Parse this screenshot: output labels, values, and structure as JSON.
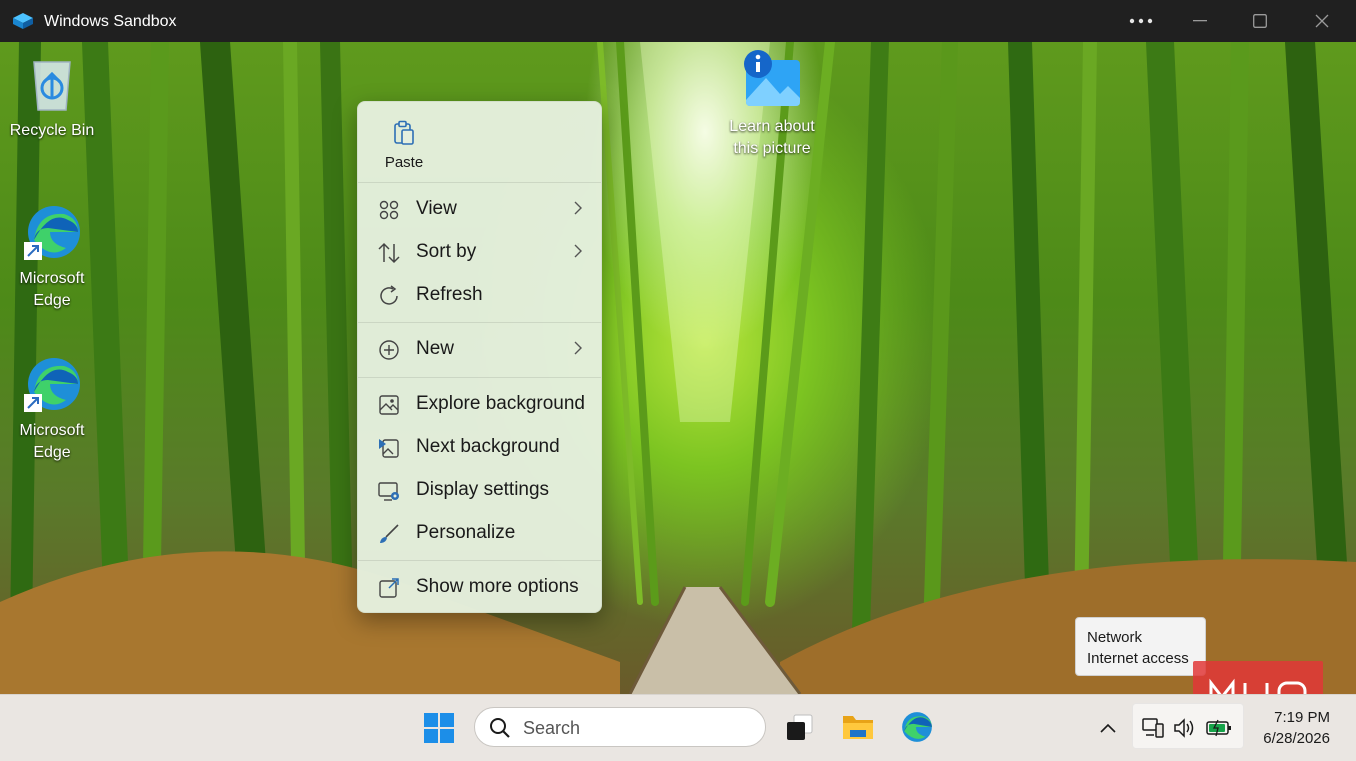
{
  "window": {
    "title": "Windows Sandbox",
    "controls": {
      "more": "more-icon",
      "minimize": "minimize-icon",
      "maximize": "maximize-icon",
      "close": "close-icon"
    }
  },
  "desktop": {
    "icons": [
      {
        "label": "Recycle Bin",
        "icon": "recycle-bin-icon"
      },
      {
        "label": "Microsoft Edge",
        "icon": "edge-shortcut-icon"
      },
      {
        "label": "Microsoft Edge",
        "icon": "edge-shortcut-icon"
      },
      {
        "label": "Learn about this picture",
        "icon": "learn-picture-icon"
      }
    ]
  },
  "context_menu": {
    "paste_label": "Paste",
    "items": [
      {
        "label": "View",
        "icon": "view-grid-icon",
        "submenu": true
      },
      {
        "label": "Sort by",
        "icon": "sort-icon",
        "submenu": true
      },
      {
        "label": "Refresh",
        "icon": "refresh-icon",
        "submenu": false
      },
      {
        "label": "New",
        "icon": "new-plus-icon",
        "submenu": true
      },
      {
        "label": "Explore background",
        "icon": "explore-background-icon",
        "submenu": false
      },
      {
        "label": "Next background",
        "icon": "next-background-icon",
        "submenu": false
      },
      {
        "label": "Display settings",
        "icon": "display-settings-icon",
        "submenu": false
      },
      {
        "label": "Personalize",
        "icon": "personalize-brush-icon",
        "submenu": false
      },
      {
        "label": "Show more options",
        "icon": "show-more-options-icon",
        "submenu": false
      }
    ]
  },
  "tooltip": {
    "line1": "Network",
    "line2": "Internet access"
  },
  "watermark": {
    "text": "MUO"
  },
  "taskbar": {
    "search_placeholder": "Search",
    "pinned": [
      "start-icon",
      "task-view-icon",
      "file-explorer-icon",
      "edge-icon"
    ],
    "tray": [
      "network-icon",
      "volume-icon",
      "battery-icon"
    ],
    "time": "7:19 PM",
    "date": "6/28/2026"
  },
  "colors": {
    "titlebar": "#202020",
    "menu_bg": "#e5efde",
    "taskbar": "#eae6e2",
    "accent_blue": "#0078d4",
    "watermark": "#e13737"
  }
}
